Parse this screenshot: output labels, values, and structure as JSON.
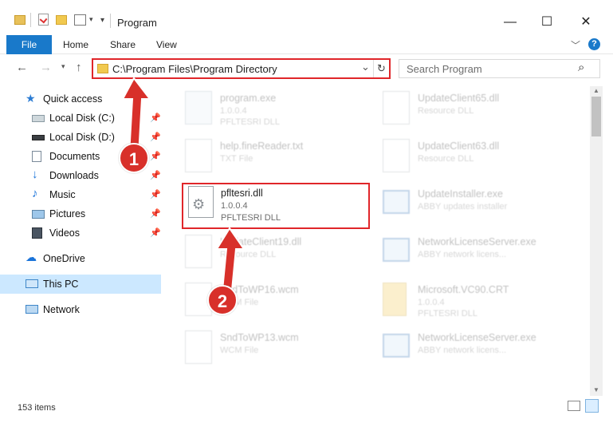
{
  "window": {
    "title": "Program",
    "minimize_glyph": "—",
    "maximize_glyph": "☐",
    "close_glyph": "✕"
  },
  "ribbon": {
    "tabs": [
      "File",
      "Home",
      "Share",
      "View"
    ],
    "collapse_glyph": "﹀",
    "help_glyph": "?"
  },
  "address": {
    "path": "C:\\Program Files\\Program Directory",
    "dropdown_glyph": "⌄",
    "refresh_glyph": "↻"
  },
  "search": {
    "placeholder": "Search Program",
    "icon_glyph": "⌕"
  },
  "sidebar": {
    "quick_access": "Quick access",
    "items": [
      {
        "label": "Local Disk (C:)",
        "icon": "drive-icon"
      },
      {
        "label": "Local Disk (D:)",
        "icon": "drive-icon"
      },
      {
        "label": "Documents",
        "icon": "documents-icon"
      },
      {
        "label": "Downloads",
        "icon": "downloads-icon"
      },
      {
        "label": "Music",
        "icon": "music-icon"
      },
      {
        "label": "Pictures",
        "icon": "pictures-icon"
      },
      {
        "label": "Videos",
        "icon": "videos-icon"
      }
    ],
    "onedrive": "OneDrive",
    "this_pc": "This PC",
    "network": "Network"
  },
  "files": {
    "left": [
      {
        "name": "program.exe",
        "line2": "1.0.0.4",
        "line3": "PFLTESRI DLL"
      },
      {
        "name": "help.fineReader.txt",
        "line2": "TXT File",
        "line3": ""
      },
      {
        "name": "pfltesri.dll",
        "line2": "1.0.0.4",
        "line3": "PFLTESRI DLL"
      },
      {
        "name": "UpdateClient19.dll",
        "line2": "Resource DLL",
        "line3": ""
      },
      {
        "name": "SndToWP16.wcm",
        "line2": "WCM File",
        "line3": ""
      },
      {
        "name": "SndToWP13.wcm",
        "line2": "WCM File",
        "line3": ""
      }
    ],
    "right": [
      {
        "name": "UpdateClient65.dll",
        "line2": "Resource DLL",
        "line3": ""
      },
      {
        "name": "UpdateClient63.dll",
        "line2": "Resource DLL",
        "line3": ""
      },
      {
        "name": "UpdateInstaller.exe",
        "line2": "ABBY updates installer",
        "line3": ""
      },
      {
        "name": "NetworkLicenseServer.exe",
        "line2": "ABBY network licens...",
        "line3": ""
      },
      {
        "name": "Microsoft.VC90.CRT",
        "line2": "1.0.0.4",
        "line3": "PFLTESRI DLL"
      },
      {
        "name": "NetworkLicenseServer.exe",
        "line2": "ABBY network licens...",
        "line3": ""
      }
    ]
  },
  "status": {
    "item_count": "153 items"
  },
  "callouts": [
    "1",
    "2"
  ],
  "colors": {
    "accent": "#1979ca",
    "highlight": "#e0262a",
    "callout": "#d8302a",
    "selected": "#cce8ff"
  }
}
